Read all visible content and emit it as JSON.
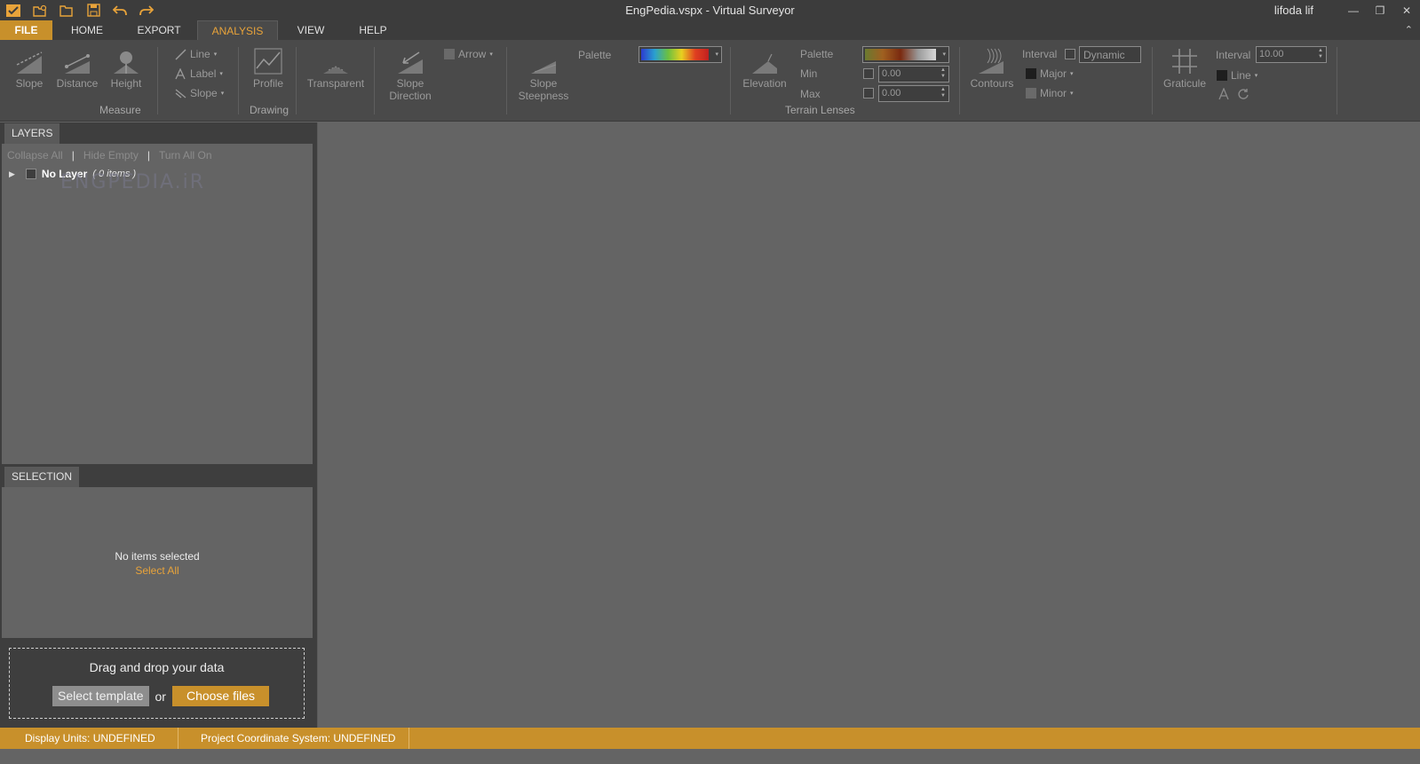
{
  "window": {
    "title": "EngPedia.vspx  -  Virtual Surveyor",
    "user": "lifoda lif"
  },
  "tabs": [
    "FILE",
    "HOME",
    "EXPORT",
    "ANALYSIS",
    "VIEW",
    "HELP"
  ],
  "ribbon": {
    "measure": {
      "slope": "Slope",
      "distance": "Distance",
      "height": "Height",
      "line": "Line",
      "label": "Label",
      "slope_small": "Slope",
      "group": "Measure"
    },
    "drawing": {
      "profile": "Profile",
      "group": "Drawing"
    },
    "transparent": "Transparent",
    "slope_direction_1": "Slope",
    "slope_direction_2": "Direction",
    "arrow": "Arrow",
    "slope_steepness_1": "Slope",
    "slope_steepness_2": "Steepness",
    "palette_label": "Palette",
    "terrain": {
      "elevation": "Elevation",
      "palette": "Palette",
      "min": "Min",
      "max": "Max",
      "min_value": "0.00",
      "max_value": "0.00",
      "group": "Terrain Lenses"
    },
    "contours": {
      "label": "Contours",
      "interval": "Interval",
      "dynamic": "Dynamic",
      "major": "Major",
      "minor": "Minor"
    },
    "graticule": {
      "label": "Graticule",
      "interval": "Interval",
      "interval_value": "10.00",
      "line": "Line"
    }
  },
  "layers": {
    "tab": "LAYERS",
    "collapse_all": "Collapse All",
    "hide_empty": "Hide Empty",
    "turn_all_on": "Turn All On",
    "separator": "|",
    "item_name": "No Layer",
    "item_count": "( 0 items )"
  },
  "watermark": "ENGPEDIA.iR",
  "selection": {
    "tab": "SELECTION",
    "empty": "No items selected",
    "select_all": "Select All"
  },
  "dropzone": {
    "title": "Drag and drop your data",
    "select_template": "Select template",
    "or": "or",
    "choose_files": "Choose files"
  },
  "status": {
    "display_units": "Display Units:  UNDEFINED",
    "coord_system": "Project Coordinate System:  UNDEFINED"
  },
  "colors": {
    "accent": "#c8902b",
    "active_tab_text": "#e8a33a"
  }
}
